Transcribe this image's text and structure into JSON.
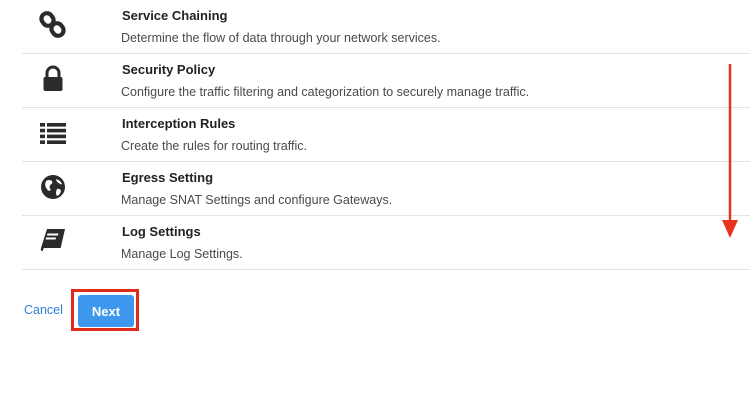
{
  "items": [
    {
      "icon": "link-icon",
      "title": "Service Chaining",
      "description": "Determine the flow of data through your network services."
    },
    {
      "icon": "lock-icon",
      "title": "Security Policy",
      "description": "Configure the traffic filtering and categorization to securely manage traffic."
    },
    {
      "icon": "list-icon",
      "title": "Interception Rules",
      "description": "Create the rules for routing traffic."
    },
    {
      "icon": "globe-icon",
      "title": "Egress Setting",
      "description": "Manage SNAT Settings and configure Gateways."
    },
    {
      "icon": "book-icon",
      "title": "Log Settings",
      "description": "Manage Log Settings."
    }
  ],
  "footer": {
    "cancel_label": "Cancel",
    "next_label": "Next"
  },
  "colors": {
    "link": "#2a7fd4",
    "primary_button": "#3d97ec",
    "highlight": "#e02a1a",
    "divider": "#e3e3e3"
  }
}
